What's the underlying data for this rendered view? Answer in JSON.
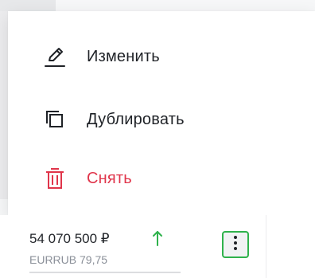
{
  "menu": {
    "items": [
      {
        "label": "Изменить",
        "icon": "pencil-icon"
      },
      {
        "label": "Дублировать",
        "icon": "duplicate-icon"
      },
      {
        "label": "Снять",
        "icon": "trash-icon"
      }
    ]
  },
  "row": {
    "amount": "54 070 500 ₽",
    "trend": "up",
    "ticker": "EURRUB 79,75",
    "more_icon": "more-vertical-icon"
  },
  "colors": {
    "danger": "#e0354b",
    "positive": "#2fb24c",
    "text": "#1f2227",
    "muted": "#8b9099"
  }
}
